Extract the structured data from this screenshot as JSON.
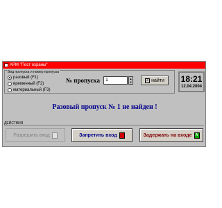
{
  "window": {
    "title": "АРМ \"Пост охраны\""
  },
  "pass_group": {
    "title": "Вид пропуска и номер пропуска",
    "options": [
      {
        "label": "разовый (F1)",
        "selected": true
      },
      {
        "label": "временный (F2)",
        "selected": false
      },
      {
        "label": "материальный (F3)",
        "selected": false
      }
    ]
  },
  "pass_number": {
    "label": "№ пропуска",
    "value": "1",
    "find_button": "найти"
  },
  "clock": {
    "time": "18:21",
    "date": "12.04.2004"
  },
  "message": "Разовый пропуск № 1 не найден !",
  "actions": {
    "title": "ДЕЙСТВИЯ",
    "allow": "Разрешить вход",
    "deny": "Запретить вход",
    "hold": "Задержать на входе"
  },
  "colors": {
    "titlebar": "#ff0000",
    "message": "#00008b",
    "window_bg": "#c0c0c0"
  }
}
